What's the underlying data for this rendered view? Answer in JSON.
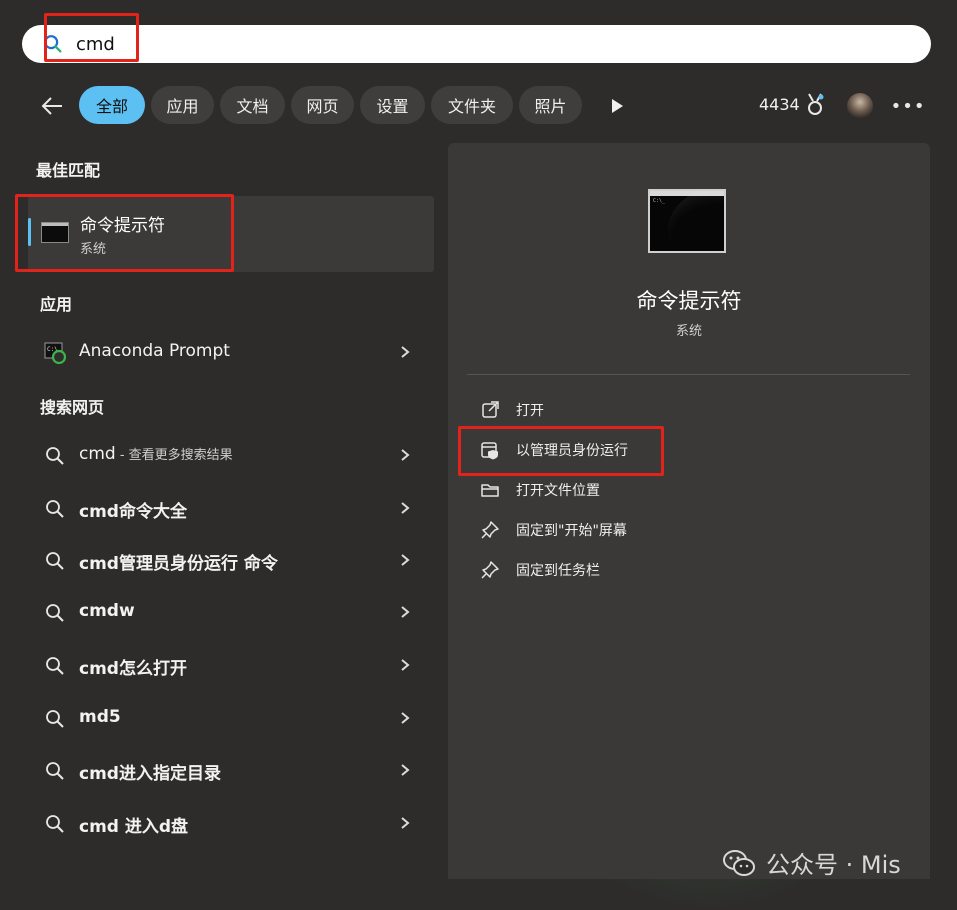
{
  "search": {
    "value": "cmd"
  },
  "filters": {
    "tabs": [
      {
        "label": "全部",
        "active": true
      },
      {
        "label": "应用"
      },
      {
        "label": "文档"
      },
      {
        "label": "网页"
      },
      {
        "label": "设置"
      },
      {
        "label": "文件夹"
      },
      {
        "label": "照片"
      }
    ],
    "points": "4434"
  },
  "left": {
    "best_match_heading": "最佳匹配",
    "best_match": {
      "title": "命令提示符",
      "subtitle": "系统"
    },
    "apps_heading": "应用",
    "apps": [
      {
        "label": "Anaconda Prompt"
      }
    ],
    "web_heading": "搜索网页",
    "web_first": {
      "label": "cmd",
      "hint": " - 查看更多搜索结果"
    },
    "web_results": [
      {
        "label": "cmd命令大全"
      },
      {
        "label": "cmd管理员身份运行 命令"
      },
      {
        "label": "cmdw"
      },
      {
        "label": "cmd怎么打开"
      },
      {
        "label": "md5"
      },
      {
        "label": "cmd进入指定目录"
      },
      {
        "label": "cmd 进入d盘"
      }
    ]
  },
  "right": {
    "title": "命令提示符",
    "subtitle": "系统",
    "actions": [
      {
        "label": "打开"
      },
      {
        "label": "以管理员身份运行"
      },
      {
        "label": "打开文件位置"
      },
      {
        "label": "固定到\"开始\"屏幕"
      },
      {
        "label": "固定到任务栏"
      }
    ]
  },
  "watermark": {
    "text": "公众号 · Mis"
  },
  "colors": {
    "accent": "#5cc0f2",
    "highlight": "#e2231a",
    "panel": "#3a3938",
    "background": "#2d2c2b"
  }
}
